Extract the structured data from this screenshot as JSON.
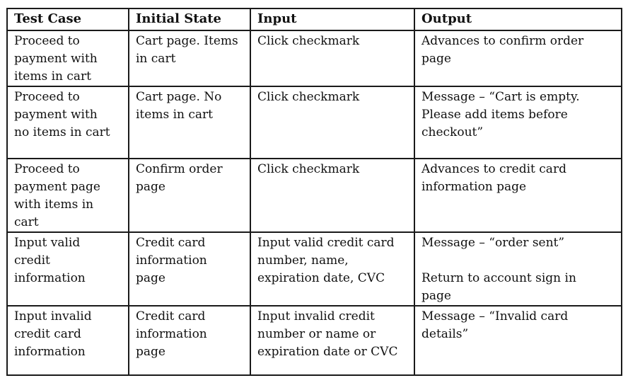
{
  "table": {
    "headers": [
      "Test Case",
      "Initial State",
      "Input",
      "Output"
    ],
    "rows": [
      [
        "Proceed to\npayment with\nitems in cart",
        "Cart page. Items\nin cart",
        "Click checkmark",
        "Advances to confirm order\npage"
      ],
      [
        "Proceed to\npayment with\nno items in cart",
        "Cart page. No\nitems in cart",
        "Click checkmark",
        "Message – “Cart is empty.\nPlease add items before\ncheckout”"
      ],
      [
        "Proceed to\npayment page\nwith items in\ncart",
        "Confirm order\npage",
        "Click checkmark",
        "Advances to credit card\ninformation page"
      ],
      [
        "Input valid\ncredit\ninformation",
        "Credit card\ninformation\npage",
        "Input valid credit card\nnumber, name,\nexpiration date, CVC",
        "Message – “order sent”\n\nReturn to account sign in\npage"
      ],
      [
        "Input invalid\ncredit card\ninformation",
        "Credit card\ninformation\npage",
        "Input invalid credit\nnumber or name or\nexpiration date or CVC",
        "Message – “Invalid card\ndetails”"
      ]
    ]
  }
}
